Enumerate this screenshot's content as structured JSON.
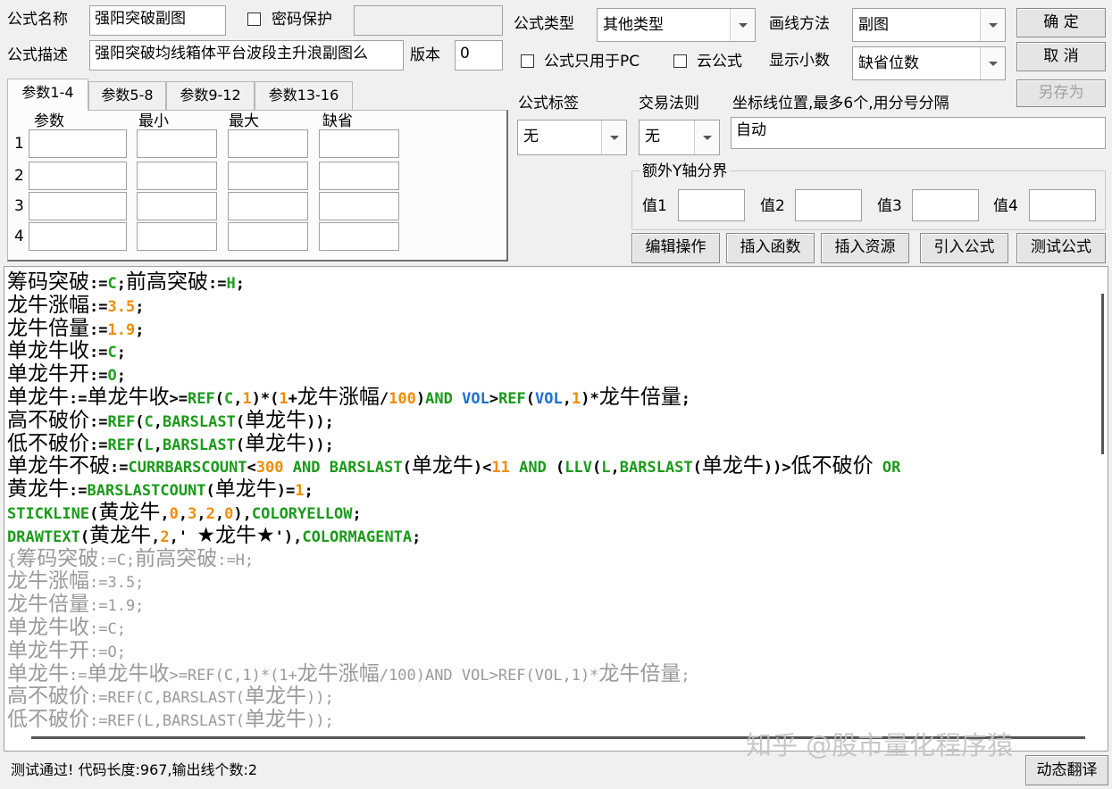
{
  "top": {
    "name_label": "公式名称",
    "name_value": "强阳突破副图",
    "password_label": "密码保护",
    "password_value": "",
    "desc_label": "公式描述",
    "desc_value": "强阳突破均线箱体平台波段主升浪副图么",
    "version_label": "版本",
    "version_value": "0",
    "type_label": "公式类型",
    "type_value": "其他类型",
    "draw_label": "画线方法",
    "draw_value": "副图",
    "pc_only_label": "公式只用于PC",
    "cloud_label": "云公式",
    "decimals_label": "显示小数",
    "decimals_value": "缺省位数"
  },
  "buttons": {
    "ok": "确  定",
    "cancel": "取  消",
    "save_as": "另存为",
    "edit_ops": "编辑操作",
    "insert_func": "插入函数",
    "insert_res": "插入资源",
    "import_formula": "引入公式",
    "test_formula": "测试公式",
    "dynamic_translate": "动态翻译"
  },
  "tabs": [
    "参数1-4",
    "参数5-8",
    "参数9-12",
    "参数13-16"
  ],
  "param_headers": [
    "参数",
    "最小",
    "最大",
    "缺省"
  ],
  "param_rows": [
    "1",
    "2",
    "3",
    "4"
  ],
  "tag": {
    "label": "公式标签",
    "value": "无"
  },
  "trade": {
    "label": "交易法则",
    "value": "无"
  },
  "axis": {
    "label": "坐标线位置,最多6个,用分号分隔",
    "value": "自动"
  },
  "yaxis": {
    "group_label": "额外Y轴分界",
    "labels": [
      "值1",
      "值2",
      "值3",
      "值4"
    ]
  },
  "code_lines": [
    "筹码突破:=C;前高突破:=H;",
    "龙牛涨幅:=3.5;",
    "龙牛倍量:=1.9;",
    "单龙牛收:=C;",
    "单龙牛开:=O;",
    "单龙牛:=单龙牛收>=REF(C,1)*(1+龙牛涨幅/100)AND VOL>REF(VOL,1)*龙牛倍量;",
    "高不破价:=REF(C,BARSLAST(单龙牛));",
    "低不破价:=REF(L,BARSLAST(单龙牛));",
    "单龙牛不破:=CURRBARSCOUNT<300 AND BARSLAST(单龙牛)<11 AND (LLV(L,BARSLAST(单龙牛))>低不破价 OR",
    "黄龙牛:=BARSLASTCOUNT(单龙牛)=1;",
    "STICKLINE(黄龙牛,0,3,2,0),COLORYELLOW;",
    "DRAWTEXT(黄龙牛,2,' ★龙牛★'),COLORMAGENTA;",
    "{筹码突破:=C;前高突破:=H;",
    "龙牛涨幅:=3.5;",
    "龙牛倍量:=1.9;",
    "单龙牛收:=C;",
    "单龙牛开:=O;",
    "单龙牛:=单龙牛收>=REF(C,1)*(1+龙牛涨幅/100)AND VOL>REF(VOL,1)*龙牛倍量;",
    "高不破价:=REF(C,BARSLAST(单龙牛));",
    "低不破价:=REF(L,BARSLAST(单龙牛));"
  ],
  "status": "测试通过! 代码长度:967,输出线个数:2",
  "watermark": "知乎 @股市量化程序猿"
}
